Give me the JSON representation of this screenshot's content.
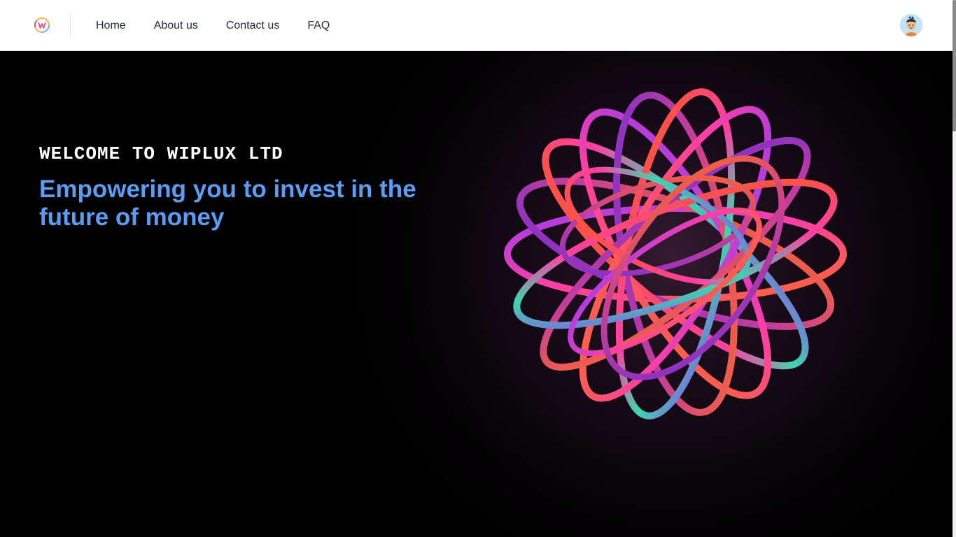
{
  "nav": {
    "logo_icon": "wiplux-logo-icon",
    "links": [
      {
        "label": "Home"
      },
      {
        "label": "About us"
      },
      {
        "label": "Contact us"
      },
      {
        "label": "FAQ"
      }
    ],
    "avatar_icon": "user-avatar-icon"
  },
  "hero": {
    "welcome": "WELCOME TO WIPLUX LTD",
    "headline": "Empowering you to invest in the future of money",
    "image_icon": "abstract-ribbon-sculpture",
    "colors": {
      "headline": "#5b9df5",
      "background": "#000000",
      "accent_orange": "#ff6a2b",
      "accent_pink": "#ff3fa5",
      "accent_purple": "#9b3cf0"
    }
  }
}
